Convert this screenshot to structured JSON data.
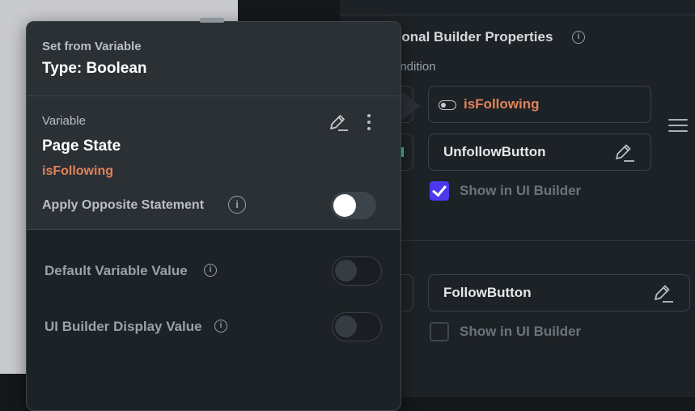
{
  "popover": {
    "header": {
      "subtitle": "Set from Variable",
      "title": "Type: Boolean"
    },
    "variable": {
      "label": "Variable",
      "source": "Page State",
      "name": "isFollowing",
      "apply_opposite_label": "Apply Opposite Statement",
      "apply_opposite_enabled": false
    },
    "options": {
      "default_value_label": "Default Variable Value",
      "default_value_enabled": false,
      "display_value_label": "UI Builder Display Value",
      "display_value_enabled": false
    }
  },
  "properties": {
    "section_title": "tional Builder Properties",
    "condition_label": "ondition",
    "condition_variable": "isFollowing",
    "cases": [
      {
        "component": "UnfollowButton",
        "show_in_builder_label": "Show in UI Builder",
        "show_in_builder": true
      },
      {
        "component": "FollowButton",
        "show_in_builder_label": "Show in UI Builder",
        "show_in_builder": false
      }
    ]
  },
  "colors": {
    "accent_orange": "#e0835a",
    "checkbox_purple": "#4b39ef",
    "panel_bg": "#1d2226",
    "popover_header_bg": "#2b3035"
  },
  "icons": {
    "info": "i",
    "edit": "pencil-icon",
    "more": "vertical-dots-icon",
    "menu": "hamburger-icon"
  }
}
